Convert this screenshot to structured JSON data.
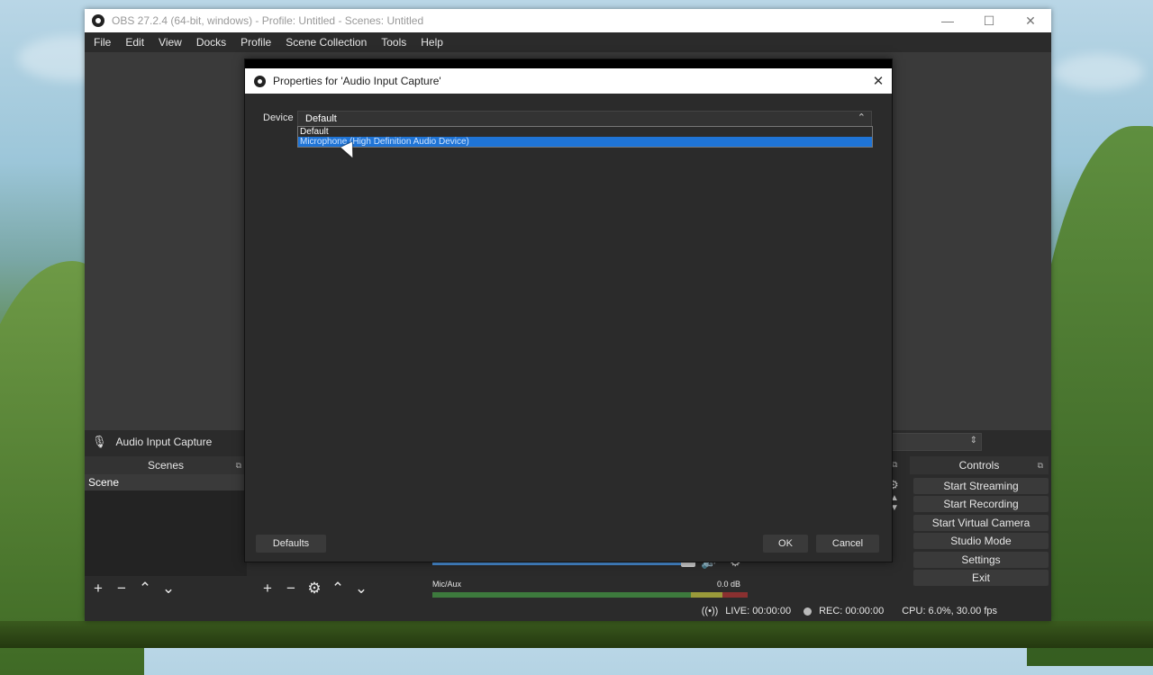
{
  "window": {
    "title": "OBS 27.2.4 (64-bit, windows) - Profile: Untitled - Scenes: Untitled",
    "minimize": "—",
    "maximize": "☐",
    "close": "✕"
  },
  "menu": [
    "File",
    "Edit",
    "View",
    "Docks",
    "Profile",
    "Scene Collection",
    "Tools",
    "Help"
  ],
  "source_bar": {
    "name": "Audio Input Capture"
  },
  "scenes": {
    "header": "Scenes",
    "items": [
      "Scene"
    ]
  },
  "controls": {
    "header": "Controls",
    "buttons": [
      "Start Streaming",
      "Start Recording",
      "Start Virtual Camera",
      "Studio Mode",
      "Settings",
      "Exit"
    ]
  },
  "mixer": {
    "name": "Mic/Aux",
    "db": "0.0 dB",
    "volume_percent": 100
  },
  "status": {
    "live": "LIVE: 00:00:00",
    "rec": "REC: 00:00:00",
    "cpu": "CPU: 6.0%, 30.00 fps"
  },
  "dialog": {
    "title": "Properties for 'Audio Input Capture'",
    "device_label": "Device",
    "device_value": "Default",
    "options": [
      "Default",
      "Microphone (High Definition Audio Device)"
    ],
    "highlighted_option": "Microphone (High Definition Audio Device)",
    "defaults_button": "Defaults",
    "ok_button": "OK",
    "cancel_button": "Cancel"
  },
  "icons": {
    "add": "+",
    "remove": "−",
    "up": "⌃",
    "down": "⌄",
    "gear": "⚙",
    "mic": "🎙",
    "speaker": "🔊"
  },
  "colors": {
    "accent": "#1f74d6",
    "panel": "#2b2b2b",
    "dark": "#232323"
  }
}
